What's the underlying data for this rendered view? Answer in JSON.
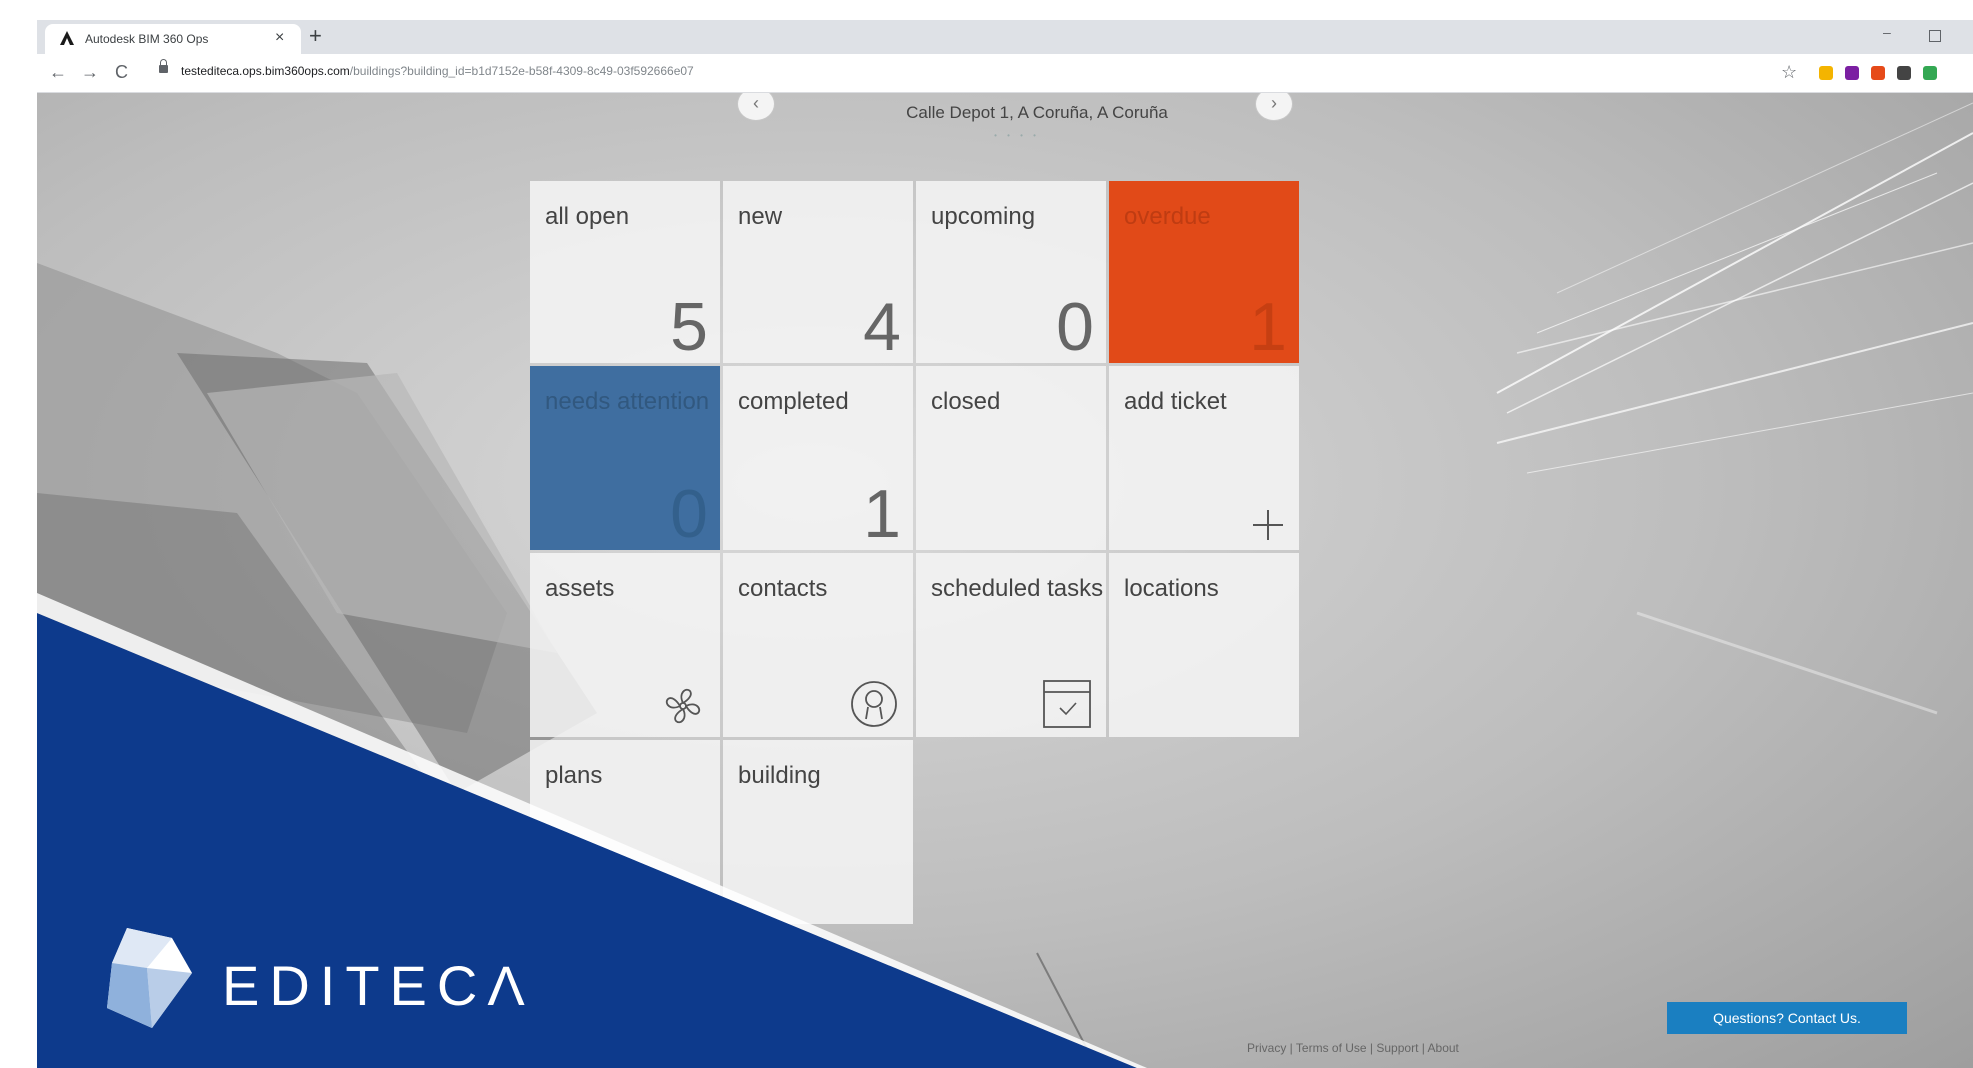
{
  "browser": {
    "tab_title": "Autodesk BIM 360 Ops",
    "tab_close": "×",
    "new_tab": "+",
    "url_domain": "testediteca.ops.bim360ops.com",
    "url_path": "/buildings?building_id=b1d7152e-b58f-4309-8c49-03f592666e07",
    "nav": {
      "back": "←",
      "forward": "→",
      "reload": "C"
    },
    "window_min": "–",
    "star": "☆"
  },
  "page": {
    "building_address": "Calle Depot 1, A Coruña, A Coruña",
    "pager_dots": "• • • •",
    "prev_arrow": "‹",
    "next_arrow": "›"
  },
  "tiles": {
    "all_open": {
      "label": "all open",
      "count": "5"
    },
    "new": {
      "label": "new",
      "count": "4"
    },
    "upcoming": {
      "label": "upcoming",
      "count": "0"
    },
    "overdue": {
      "label": "overdue",
      "count": "1"
    },
    "needs_attention": {
      "label": "needs attention",
      "count": "0"
    },
    "completed": {
      "label": "completed",
      "count": "1"
    },
    "closed": {
      "label": "closed"
    },
    "add_ticket": {
      "label": "add ticket"
    },
    "assets": {
      "label": "assets"
    },
    "contacts": {
      "label": "contacts"
    },
    "scheduled_tasks": {
      "label": "scheduled tasks"
    },
    "locations": {
      "label": "locations"
    },
    "plans": {
      "label": "plans"
    },
    "building": {
      "label": "building"
    }
  },
  "watermark": {
    "brand": "EDITECΛ"
  },
  "contact_button": "Questions? Contact Us.",
  "footer": "Privacy | Terms of Use | Support | About",
  "colors": {
    "overdue": "#e14a18",
    "needs_attention": "#3f6ea0",
    "brand_band": "#0d3a8c",
    "contact_button": "#1a7fc1"
  }
}
